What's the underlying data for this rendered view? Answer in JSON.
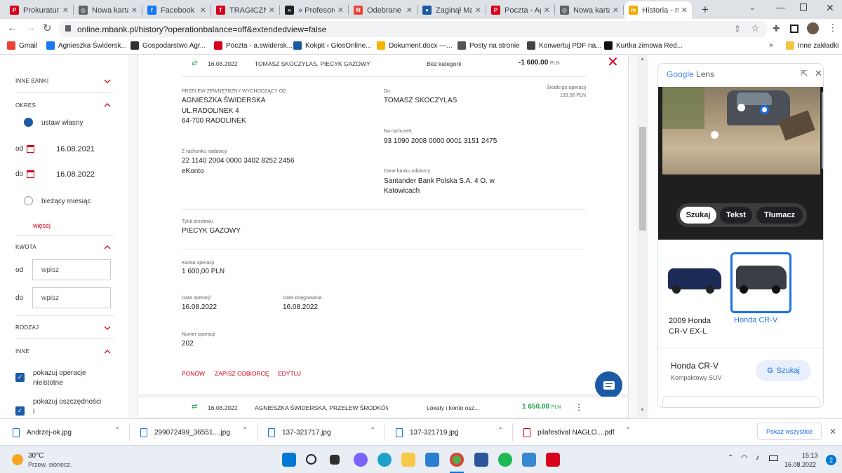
{
  "tabs": [
    {
      "title": "Prokuratura",
      "color": "#d6001c",
      "glyph": "P"
    },
    {
      "title": "Nowa karta",
      "color": "#5f6368",
      "glyph": "◎"
    },
    {
      "title": "Facebook",
      "color": "#1877f2",
      "glyph": "f"
    },
    {
      "title": "TRAGICZNE",
      "color": "#d6001c",
      "glyph": "T"
    },
    {
      "title": "» Profesoro",
      "color": "#222",
      "glyph": "»"
    },
    {
      "title": "Odebrane (",
      "color": "#ea4335",
      "glyph": "M"
    },
    {
      "title": "Zaginął Ma",
      "color": "#1a5aa0",
      "glyph": "●"
    },
    {
      "title": "Poczta - Ag",
      "color": "#d6001c",
      "glyph": "P"
    },
    {
      "title": "Nowa karta",
      "color": "#5f6368",
      "glyph": "◎"
    },
    {
      "title": "Historia - n",
      "color": "#f2a900",
      "glyph": "m"
    }
  ],
  "url": "online.mbank.pl/history?operationbalance=off&extendedview=false",
  "bookmarks": [
    {
      "label": "Gmail",
      "color": "#ea4335"
    },
    {
      "label": "Agnieszka Świdersk...",
      "color": "#1877f2"
    },
    {
      "label": "Gospodarstwo Agr...",
      "color": "#333"
    },
    {
      "label": "Poczta - a.swidersk...",
      "color": "#d6001c"
    },
    {
      "label": "Kokpit ‹ GłosOnline...",
      "color": "#1a5aa0"
    },
    {
      "label": "Dokument.docx —...",
      "color": "#f4b400"
    },
    {
      "label": "Posty na stronie",
      "color": "#555"
    },
    {
      "label": "Konwertuj PDF na...",
      "color": "#444"
    },
    {
      "label": "Kurtka zimowa Red...",
      "color": "#111"
    },
    {
      "label": "Inne zakładki",
      "color": "#f4c542"
    }
  ],
  "sidebar": {
    "inne_banki": "INNE BANKI",
    "okres": "OKRES",
    "ustaw_wlasny": "ustaw własny",
    "od": "od",
    "do": "do",
    "date_from": "16.08.2021",
    "date_to": "16.08.2022",
    "biezacy": "bieżący miesiąc",
    "wiecej": "więcej",
    "kwota": "KWOTA",
    "placeholder": "wpisz",
    "rodzaj": "RODZAJ",
    "inne": "INNE",
    "chk1": "pokazuj operacje nieistotne",
    "chk2": "pokazuj oszczędności i"
  },
  "transaction": {
    "date": "16.08.2022",
    "title": "TOMASZ SKOCZYLAS, PIECYK GAZOWY",
    "category": "Bez kategorii",
    "amount": "-1 600.00",
    "currency": "PLN",
    "type_label": "PRZELEW ZEWNĘTRZNY WYCHODZĄCY od",
    "sender_name": "AGNIESZKA ŚWIDERSKA",
    "sender_street": "UL.RADOLINEK 4",
    "sender_city": "64-700 RADOLINEK",
    "to_label": "Do",
    "recipient": "TOMASZ SKOCZYLAS",
    "funds_label": "Środki po operacji",
    "funds_value": "193.56 PLN",
    "account_to_label": "Na rachunek",
    "account_to": "93 1090 2008 0000 0001 3151 2475",
    "account_from_label": "Z rachunku nadawcy",
    "account_from": "22 1140 2004 0000 3402 8252 2456",
    "account_from_name": "eKonto",
    "bank_label": "Dane banku odbiorcy",
    "bank": "Santander Bank Polska S.A. 4 O. w Katowicach",
    "tytul_label": "Tytuł przelewu",
    "tytul": "PIECYK GAZOWY",
    "kwota_label": "Kwota operacji",
    "kwota": "1 600,00 PLN",
    "data_op_label": "Data operacji",
    "data_op": "16.08.2022",
    "data_ks_label": "Data księgowania",
    "data_ks": "16.08.2022",
    "numer_label": "Numer operacji",
    "numer": "202",
    "actions": [
      "PONÓW",
      "ZAPISZ ODBIORCĘ",
      "EDYTUJ"
    ]
  },
  "next_row": {
    "date": "16.08.2022",
    "title": "AGNIESZKA ŚWIDERSKA, PRZELEW ŚRODKÓW",
    "category": "Lokaty i konto osz...",
    "amount": "1 650.00",
    "currency": "PLN"
  },
  "lens": {
    "title_google": "Google",
    "title_lens": "Lens",
    "btn_search": "Szukaj",
    "btn_text": "Tekst",
    "btn_translate": "Tłumacz",
    "result1": "2009 Honda CR-V EX-L",
    "result2": "Honda CR-V",
    "card_title": "Honda CR-V",
    "card_sub": "Kompaktowy SUV",
    "card_btn": "Szukaj"
  },
  "downloads": {
    "items": [
      "Andrzej-ok.jpg",
      "299072499_36551....jpg",
      "137-321717.jpg",
      "137-321719.jpg",
      "pilafestival NAGŁO....pdf"
    ],
    "show_all": "Pokaż wszystkie"
  },
  "taskbar": {
    "temp": "30°C",
    "weather": "Przew. słonecz.",
    "time": "15:13",
    "date": "16.08.2022",
    "badge": "2"
  }
}
